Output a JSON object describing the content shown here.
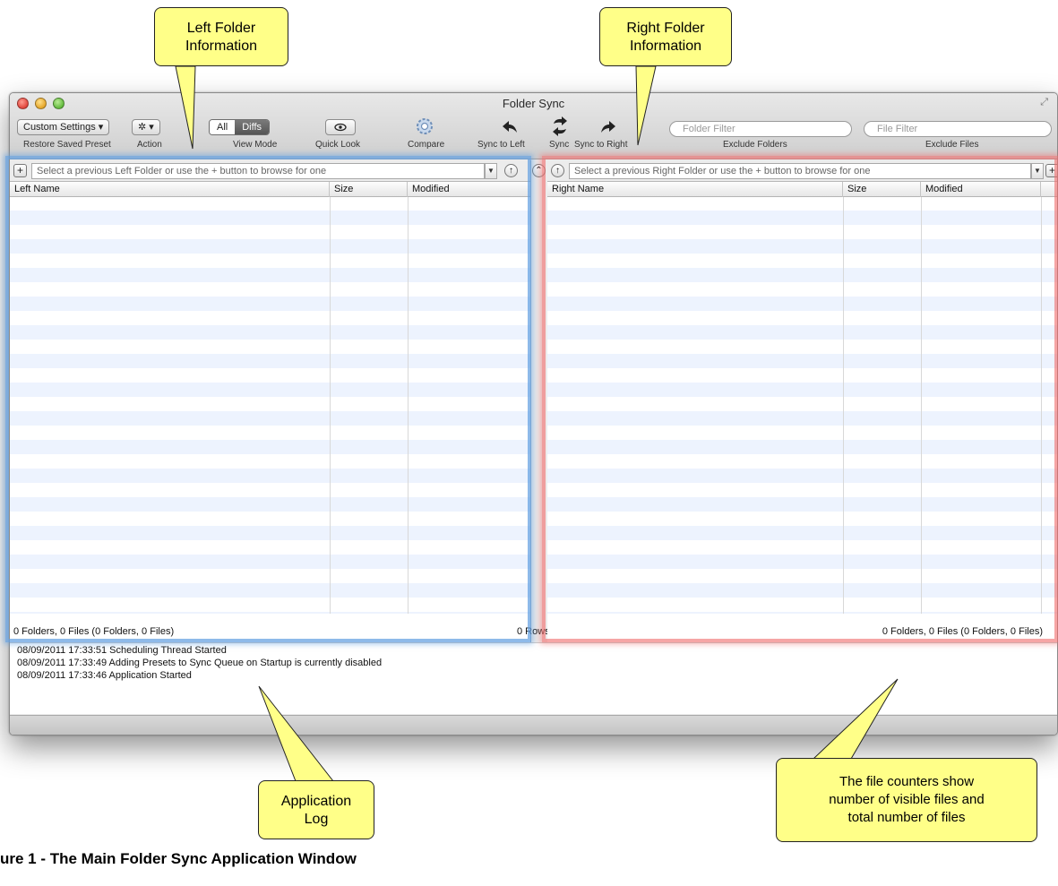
{
  "window": {
    "title": "Folder Sync"
  },
  "toolbar": {
    "preset_button": "Custom Settings ▾",
    "preset_label": "Restore Saved Preset",
    "action_button": "✲ ▾",
    "action_label": "Action",
    "view_mode_options": [
      "All",
      "Diffs"
    ],
    "view_mode_selected": "Diffs",
    "view_mode_label": "View Mode",
    "quick_look_label": "Quick Look",
    "compare_label": "Compare",
    "sync_left_label": "Sync to Left",
    "sync_label": "Sync",
    "sync_right_label": "Sync to Right",
    "folder_filter_placeholder": "Folder Filter",
    "folder_filter_label": "Exclude Folders",
    "file_filter_placeholder": "File Filter",
    "file_filter_label": "Exclude Files"
  },
  "left_pane": {
    "path_placeholder": "Select a previous Left Folder or use the + button to browse for one",
    "columns": [
      "Left Name",
      "Size",
      "Modified"
    ],
    "status": "0 Folders, 0 Files (0 Folders, 0 Files)",
    "rows_count": "0 Rows"
  },
  "right_pane": {
    "path_placeholder": "Select a previous Right Folder or use the + button to browse for one",
    "columns": [
      "Right Name",
      "Size",
      "Modified"
    ],
    "status": "0 Folders, 0 Files (0 Folders, 0 Files)"
  },
  "log": {
    "entries": [
      "08/09/2011 17:33:51  Scheduling Thread Started",
      "08/09/2011 17:33:49  Adding Presets to Sync Queue on Startup is currently disabled",
      "08/09/2011 17:33:46  Application Started"
    ]
  },
  "callouts": {
    "left_folder": [
      "Left Folder",
      "Information"
    ],
    "right_folder": [
      "Right Folder",
      "Information"
    ],
    "app_log": [
      "Application",
      "Log"
    ],
    "file_counters": [
      "The file counters show",
      "number of visible files and",
      "total number of files"
    ]
  },
  "caption": "ure 1 - The Main Folder Sync Application Window",
  "colors": {
    "callout_fill": "#ffff88",
    "left_highlight": "#62a0e0",
    "right_highlight": "#f06e6e",
    "row_stripe": "#edf3fe"
  },
  "icons": {
    "quick_look": "eye-icon",
    "compare": "gear-icon",
    "sync_left": "curved-arrow-left-icon",
    "sync": "bidirectional-arrows-icon",
    "sync_right": "curved-arrow-right-icon",
    "add_folder": "plus-icon",
    "parent_folder": "up-arrow-icon",
    "swap_panes": "double-chevron-up-icon"
  }
}
